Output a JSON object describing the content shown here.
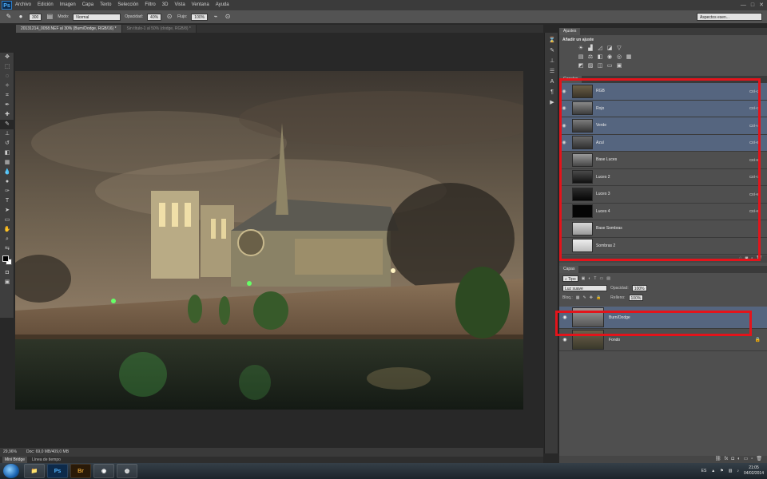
{
  "app": {
    "logo": "Ps"
  },
  "menu": {
    "items": [
      "Archivo",
      "Edición",
      "Imagen",
      "Capa",
      "Texto",
      "Selección",
      "Filtro",
      "3D",
      "Vista",
      "Ventana",
      "Ayuda"
    ]
  },
  "options": {
    "brush_size": "300",
    "mode_label": "Modo:",
    "mode_value": "Normal",
    "opacity_label": "Opacidad:",
    "opacity_value": "40%",
    "flow_label": "Flujo:",
    "flow_value": "100%",
    "workspace": "Aspectos esen..."
  },
  "doc_tabs": [
    {
      "label": "20131214_0058.NEF al 30% (Burn/Dodge, RGB/16) *",
      "active": true
    },
    {
      "label": "Sin título-1 al 50% (dodge, RGB/8) *",
      "active": false
    }
  ],
  "status": {
    "zoom": "29,96%",
    "doc": "Doc: 69,0 MB/409,0 MB"
  },
  "mini_bridge": {
    "tabs": [
      "Mini Bridge",
      "Línea de tiempo"
    ]
  },
  "adjustments": {
    "tab": "Ajustes",
    "title": "Añadir un ajuste"
  },
  "channels": {
    "tab": "Canales",
    "rows": [
      {
        "name": "RGB",
        "shortcut": "Ctrl+2",
        "selected": true
      },
      {
        "name": "Rojo",
        "shortcut": "Ctrl+3",
        "selected": true
      },
      {
        "name": "Verde",
        "shortcut": "Ctrl+4",
        "selected": true
      },
      {
        "name": "Azul",
        "shortcut": "Ctrl+5",
        "selected": true
      },
      {
        "name": "Base Luces",
        "shortcut": "Ctrl+6",
        "selected": false
      },
      {
        "name": "Luces 2",
        "shortcut": "Ctrl+7",
        "selected": false
      },
      {
        "name": "Luces 3",
        "shortcut": "Ctrl+8",
        "selected": false
      },
      {
        "name": "Luces 4",
        "shortcut": "Ctrl+9",
        "selected": false
      },
      {
        "name": "Base Sombras",
        "shortcut": "",
        "selected": false
      },
      {
        "name": "Sombras 2",
        "shortcut": "",
        "selected": false
      }
    ]
  },
  "layers": {
    "tab": "Capas",
    "filter": "Tipo",
    "blend": "Luz suave",
    "opacity_label": "Opacidad:",
    "opacity_value": "100%",
    "lock_label": "Bloq.:",
    "fill_label": "Relleno:",
    "fill_value": "100%",
    "rows": [
      {
        "name": "Burn/Dodge",
        "selected": true
      },
      {
        "name": "Fondo",
        "selected": false
      }
    ]
  },
  "taskbar": {
    "apps": [
      "Br"
    ],
    "lang": "ES",
    "time": "21:05",
    "date": "04/02/2014"
  },
  "colors": {
    "highlight": "#e3141b",
    "selection": "#55657f"
  },
  "icons": [
    "search-icon",
    "eye-icon",
    "lock-icon",
    "brush-icon",
    "move-icon"
  ]
}
